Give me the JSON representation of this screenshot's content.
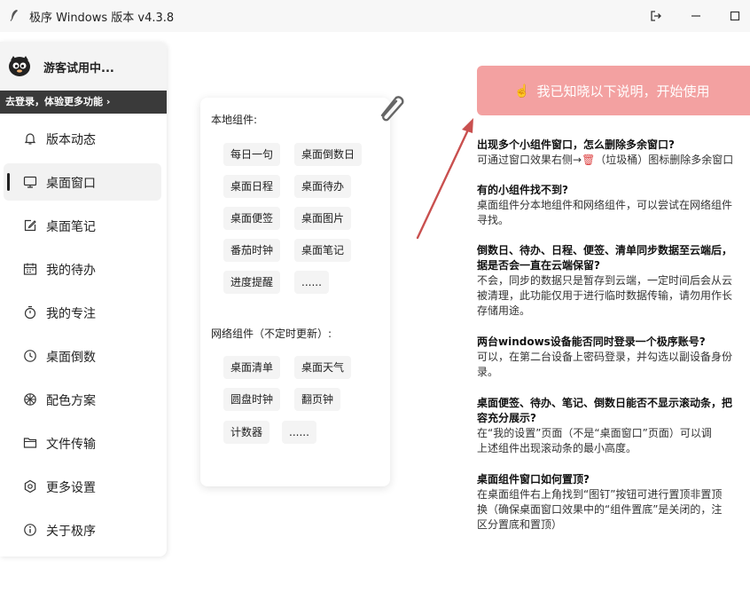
{
  "window": {
    "title": "极序 Windows 版本 v4.3.8",
    "app_icon": "feather-icon"
  },
  "user": {
    "name": "游客试用中...",
    "login_prompt": "去登录，体验更多功能 ›"
  },
  "sidebar": {
    "items": [
      {
        "label": "版本动态",
        "icon": "bell-icon",
        "active": false
      },
      {
        "label": "桌面窗口",
        "icon": "monitor-icon",
        "active": true
      },
      {
        "label": "桌面笔记",
        "icon": "edit-icon",
        "active": false
      },
      {
        "label": "我的待办",
        "icon": "calendar-icon",
        "active": false
      },
      {
        "label": "我的专注",
        "icon": "timer-icon",
        "active": false
      },
      {
        "label": "桌面倒数",
        "icon": "countdown-icon",
        "active": false
      },
      {
        "label": "配色方案",
        "icon": "palette-icon",
        "active": false
      },
      {
        "label": "文件传输",
        "icon": "folder-icon",
        "active": false
      },
      {
        "label": "更多设置",
        "icon": "gear-icon",
        "active": false
      },
      {
        "label": "关于极序",
        "icon": "info-icon",
        "active": false
      }
    ]
  },
  "widgets": {
    "local_label": "本地组件:",
    "local": [
      "每日一句",
      "桌面倒数日",
      "桌面日程",
      "桌面待办",
      "桌面便签",
      "桌面图片",
      "番茄时钟",
      "桌面笔记",
      "进度提醒",
      "......"
    ],
    "network_label": "网络组件（不定时更新）:",
    "network": [
      "桌面清单",
      "桌面天气",
      "圆盘时钟",
      "翻页钟",
      "计数器",
      "......"
    ]
  },
  "main": {
    "ack_button": "我已知晓以下说明，开始使用",
    "faq": [
      {
        "q": "出现多个小组件窗口，怎么删除多余窗口?",
        "a": [
          "可通过窗口效果右侧→",
          "（垃圾桶）图标删除多余窗口"
        ]
      },
      {
        "q": "有的小组件找不到?",
        "a": [
          "桌面组件分本地组件和网络组件，可以尝试在网络组件",
          "寻找。"
        ]
      },
      {
        "q": "倒数日、待办、日程、便签、清单同步数据至云端后，",
        "q2": "据是否会一直在云端保留?",
        "a": [
          "不会，同步的数据只是暂存到云端，一定时间后会从云",
          "被清理，此功能仅用于进行临时数据传输，请勿用作长",
          "存储用途。"
        ]
      },
      {
        "q": "两台windows设备能否同时登录一个极序账号?",
        "a": [
          "可以，在第二台设备上密码登录，并勾选以副设备身份",
          "录。"
        ]
      },
      {
        "q": "桌面便签、待办、笔记、倒数日能否不显示滚动条，把",
        "q2": "容充分展示?",
        "a": [
          "在“我的设置”页面（不是“桌面窗口”页面）可以调",
          "上述组件出现滚动条的最小高度。"
        ]
      },
      {
        "q": "桌面组件窗口如何置顶?",
        "a": [
          "在桌面组件右上角找到“图钉”按钮可进行置顶非置顶",
          "换（确保桌面窗口效果中的“组件置底”是关闭的，注",
          "区分置底和置顶）"
        ]
      }
    ]
  },
  "colors": {
    "accent_button": "#f3a1a1",
    "arrow": "#c9504f",
    "login_bar": "#3a3a3a"
  }
}
